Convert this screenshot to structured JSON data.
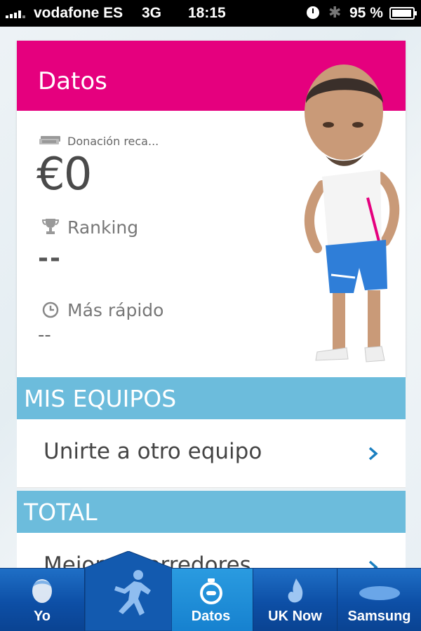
{
  "status_bar": {
    "carrier": "vodafone ES",
    "network": "3G",
    "time": "18:15",
    "battery": "95 %"
  },
  "card": {
    "title": "Datos",
    "donation_label": "Donación reca...",
    "donation_value": "€0",
    "ranking_label": "Ranking",
    "ranking_value": "--",
    "fastest_label": "Más rápido",
    "fastest_value": "--"
  },
  "sections": {
    "teams_header": "MIS EQUIPOS",
    "join_team": "Unirte a otro equipo",
    "total_header": "TOTAL",
    "best_runners": "Mejores corredores"
  },
  "tabs": [
    {
      "label": "Yo",
      "icon": "face-icon"
    },
    {
      "label": "",
      "icon": "runner-icon"
    },
    {
      "label": "Datos",
      "icon": "stopwatch-icon"
    },
    {
      "label": "UK Now",
      "icon": "flame-icon"
    },
    {
      "label": "Samsung",
      "icon": "samsung-logo-icon"
    }
  ],
  "colors": {
    "header_pink": "#e5007e",
    "section_blue": "#6cbcdc",
    "tabbar_blue": "#0d4fa6",
    "active_tab": "#1f8fd8",
    "chevron": "#1a7fc0"
  }
}
